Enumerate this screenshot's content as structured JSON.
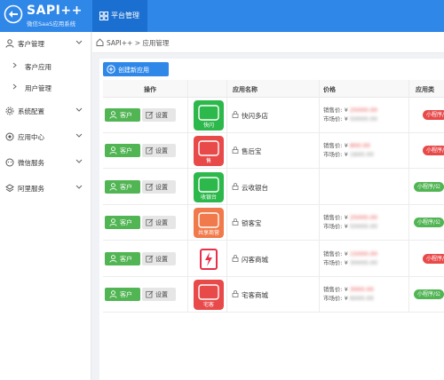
{
  "brand": {
    "title": "SAPI++",
    "subtitle": "微信SaaS应用系统"
  },
  "topnav": {
    "label": "平台管理"
  },
  "sidebar": {
    "items": [
      {
        "label": "客户管理",
        "icon": "user-icon"
      },
      {
        "label": "客户应用",
        "icon": "chevron-right-icon"
      },
      {
        "label": "用户管理",
        "icon": "chevron-right-icon"
      },
      {
        "label": "系统配置",
        "icon": "gear-icon"
      },
      {
        "label": "应用中心",
        "icon": "grid-icon"
      },
      {
        "label": "微信服务",
        "icon": "chat-icon"
      },
      {
        "label": "阿里服务",
        "icon": "layers-icon"
      }
    ]
  },
  "breadcrumb": {
    "text": "SAPI++ > 应用管理"
  },
  "toolbar": {
    "create_label": "创建新应用"
  },
  "table": {
    "headers": {
      "action": "操作",
      "name": "应用名称",
      "price": "价格",
      "type": "应用类"
    },
    "row_buttons": {
      "customer": "客户",
      "settings": "设置"
    },
    "price_labels": {
      "sale": "销售价: ¥",
      "market": "市场价: ¥"
    },
    "rows": [
      {
        "name": "快闪多店",
        "icon_text": "快闪",
        "icon_color": "#2db84c",
        "sale": "25000.00",
        "market": "50000.00",
        "type": "小程序/",
        "type_color": "#e84a4a"
      },
      {
        "name": "售后宝",
        "icon_text": "售",
        "icon_color": "#e84a4a",
        "sale": "800.00",
        "market": "1600.00",
        "type": "小程序/",
        "type_color": "#e84a4a"
      },
      {
        "name": "云收银台",
        "icon_text": "收银台",
        "icon_color": "#2db84c",
        "sale": "",
        "market": "",
        "type": "小程序/公",
        "type_color": "#52b554"
      },
      {
        "name": "锁客宝",
        "icon_text": "共享商营",
        "icon_color": "#f07a4b",
        "sale": "25000.00",
        "market": "50000.00",
        "type": "小程序/公",
        "type_color": "#52b554"
      },
      {
        "name": "闪客商城",
        "icon_text": "",
        "icon_color": "#e8304a",
        "sale": "15000.00",
        "market": "30000.00",
        "type": "小程序/",
        "type_color": "#e84a4a"
      },
      {
        "name": "宅客商城",
        "icon_text": "宅客",
        "icon_color": "#e84a4a",
        "sale": "3000.00",
        "market": "6000.00",
        "type": "小程序/公",
        "type_color": "#52b554"
      }
    ]
  }
}
